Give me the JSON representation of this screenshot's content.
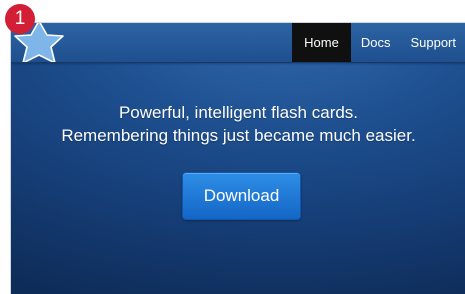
{
  "badge": {
    "number": "1",
    "color": "#d21f35"
  },
  "navbar": {
    "logo_icon": "star-icon",
    "links": [
      {
        "label": "Home",
        "active": true
      },
      {
        "label": "Docs",
        "active": false
      },
      {
        "label": "Support",
        "active": false
      }
    ]
  },
  "hero": {
    "line1": "Powerful, intelligent flash cards.",
    "line2": "Remembering things just became much easier.",
    "download_label": "Download"
  },
  "colors": {
    "background": "#1d4e8e",
    "nav_active": "#101010",
    "button": "#1f7ad8"
  }
}
